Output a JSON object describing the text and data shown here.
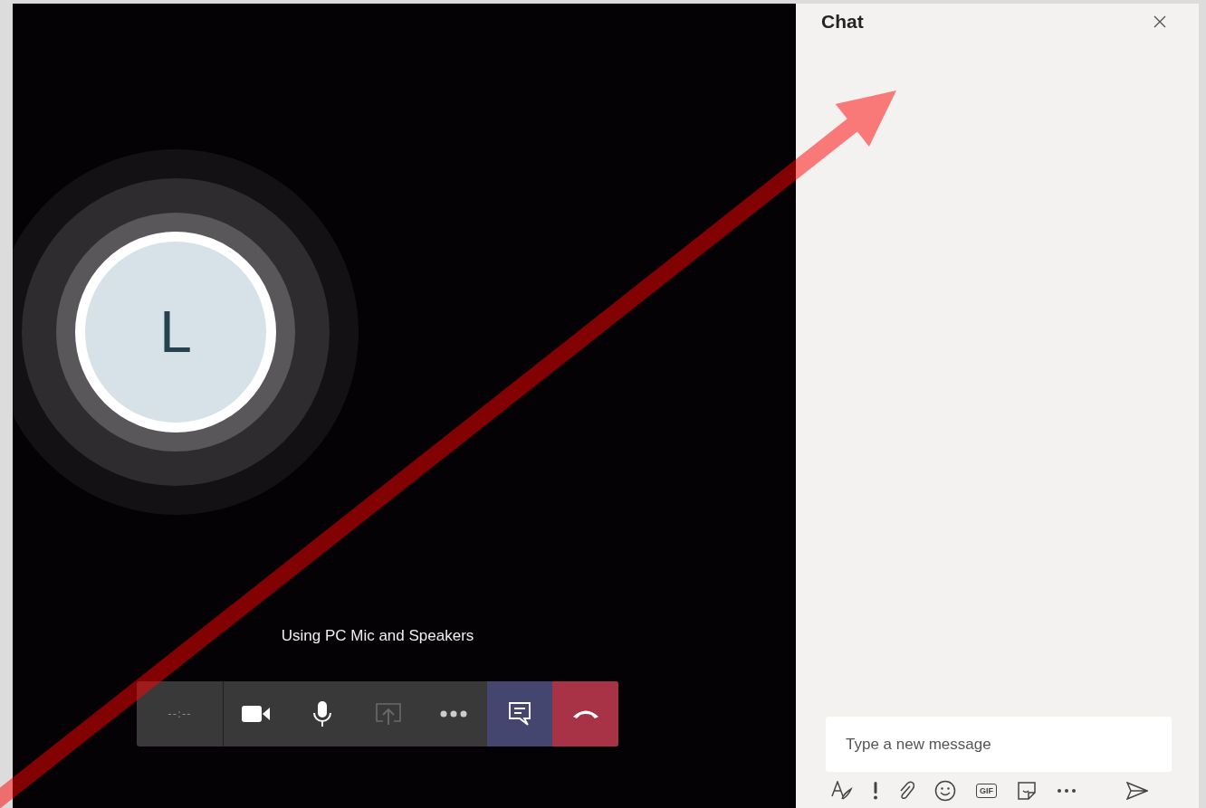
{
  "call": {
    "avatar": {
      "initial": "L"
    },
    "status": "Using PC Mic and Speakers",
    "toolbar": {
      "timer": "--:--",
      "buttons": [
        {
          "kind": "camera",
          "selected": false,
          "disabled": false
        },
        {
          "kind": "mic",
          "selected": false,
          "disabled": false
        },
        {
          "kind": "share",
          "selected": false,
          "disabled": true
        },
        {
          "kind": "more",
          "selected": false,
          "disabled": false
        },
        {
          "kind": "chat",
          "selected": true,
          "disabled": false
        },
        {
          "kind": "hangup",
          "selected": false,
          "disabled": false
        }
      ]
    }
  },
  "chat": {
    "title": "Chat",
    "compose": {
      "placeholder": "Type a new message"
    },
    "tools": [
      {
        "kind": "format"
      },
      {
        "kind": "important"
      },
      {
        "kind": "attach"
      },
      {
        "kind": "emoji"
      },
      {
        "kind": "gif",
        "label": "GIF"
      },
      {
        "kind": "sticker"
      },
      {
        "kind": "more"
      },
      {
        "kind": "send"
      }
    ]
  },
  "annotation": {
    "kind": "arrow"
  }
}
